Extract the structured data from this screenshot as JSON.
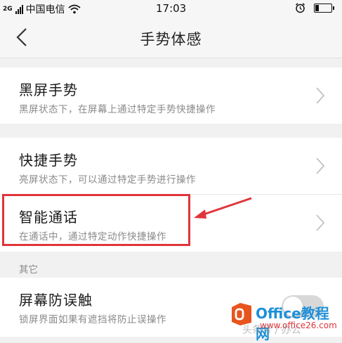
{
  "status_bar": {
    "network": "2G",
    "carrier": "中国电信",
    "time": "17:03",
    "battery_level": 0.2
  },
  "header": {
    "title": "手势体感"
  },
  "items": [
    {
      "title": "黑屏手势",
      "subtitle": "黑屏状态下，在屏幕上通过特定手势快捷操作"
    },
    {
      "title": "快捷手势",
      "subtitle": "亮屏状态下，可以通过特定手势进行操作"
    },
    {
      "title": "智能通话",
      "subtitle": "在通话中，通过特定动作快捷操作"
    }
  ],
  "other_section": {
    "header": "其它",
    "item": {
      "title": "屏幕防误触",
      "subtitle": "锁屏界面如果有遮挡将防止误操作"
    }
  },
  "watermark": {
    "brand": "Office教程网",
    "url": "www.office26.com",
    "faint_text": "头条号 / 办公"
  },
  "colors": {
    "annotation": "#e0353a",
    "watermark_blue": "#1e90d8",
    "watermark_orange": "#e8541e"
  }
}
